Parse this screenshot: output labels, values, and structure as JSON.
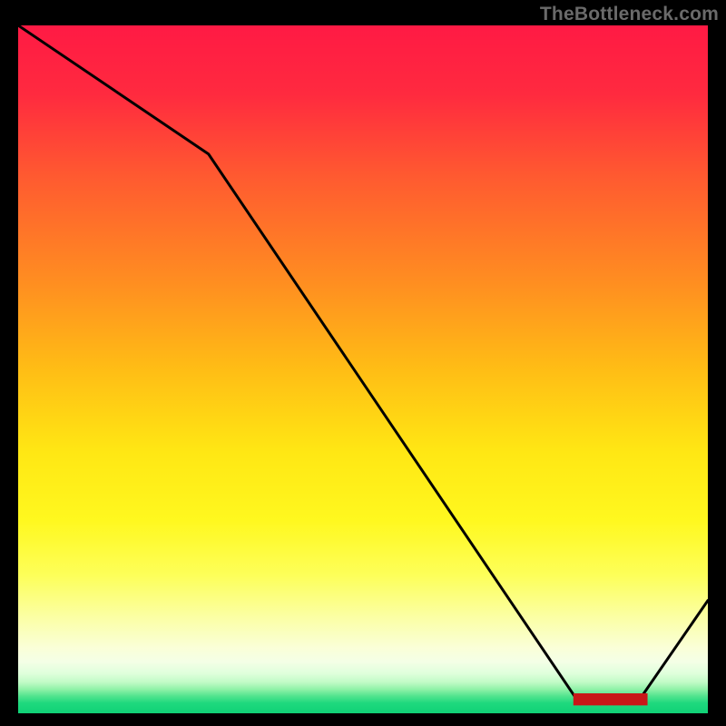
{
  "watermark": "TheBottleneck.com",
  "chart_data": {
    "type": "line",
    "title": "",
    "xlabel": "",
    "ylabel": "",
    "xlim": [
      0,
      100
    ],
    "ylim": [
      0,
      100
    ],
    "gradient_stops": [
      {
        "offset": 0.0,
        "color": "#ff1a44"
      },
      {
        "offset": 0.1,
        "color": "#ff2a3f"
      },
      {
        "offset": 0.22,
        "color": "#ff5a30"
      },
      {
        "offset": 0.38,
        "color": "#ff9020"
      },
      {
        "offset": 0.5,
        "color": "#ffbd15"
      },
      {
        "offset": 0.62,
        "color": "#ffe714"
      },
      {
        "offset": 0.72,
        "color": "#fff81f"
      },
      {
        "offset": 0.8,
        "color": "#fdff5a"
      },
      {
        "offset": 0.86,
        "color": "#fbffa4"
      },
      {
        "offset": 0.905,
        "color": "#faffd8"
      },
      {
        "offset": 0.925,
        "color": "#f4ffe6"
      },
      {
        "offset": 0.942,
        "color": "#dfffdc"
      },
      {
        "offset": 0.955,
        "color": "#c1fbc6"
      },
      {
        "offset": 0.965,
        "color": "#90f2a8"
      },
      {
        "offset": 0.975,
        "color": "#52e48e"
      },
      {
        "offset": 0.985,
        "color": "#1fd97e"
      },
      {
        "offset": 1.0,
        "color": "#10d176"
      }
    ],
    "series": [
      {
        "name": "bottleneck-curve",
        "x": [
          0.0,
          27.6,
          81.0,
          90.1,
          100.0
        ],
        "values": [
          100.0,
          81.3,
          2.0,
          2.0,
          16.4
        ]
      }
    ],
    "annotations": [
      {
        "name": "x-axis-marker",
        "x": 85.5,
        "y": 2.0,
        "text": "███████████"
      }
    ]
  }
}
